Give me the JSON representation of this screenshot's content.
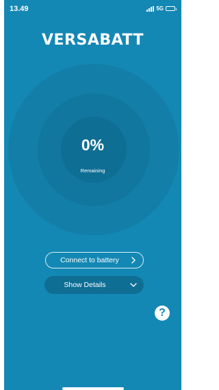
{
  "status_bar": {
    "time": "13.49",
    "network": "5G"
  },
  "brand": {
    "logo_text": "VERSABATT"
  },
  "gauge": {
    "percent_text": "0%",
    "caption": "Remaining"
  },
  "actions": {
    "connect_label": "Connect to battery",
    "details_label": "Show Details"
  },
  "help": {
    "glyph": "?"
  },
  "icons": {
    "signal": "signal-bars-icon",
    "battery": "battery-icon",
    "connect_chevron": "chevron-right-icon",
    "details_chevron": "chevron-down-icon",
    "help": "question-icon"
  },
  "colors": {
    "background": "#1488b4",
    "ring_outer": "#137fa9",
    "ring_mid": "#11779f",
    "ring_inner": "#0f6e94",
    "text": "#ffffff"
  }
}
